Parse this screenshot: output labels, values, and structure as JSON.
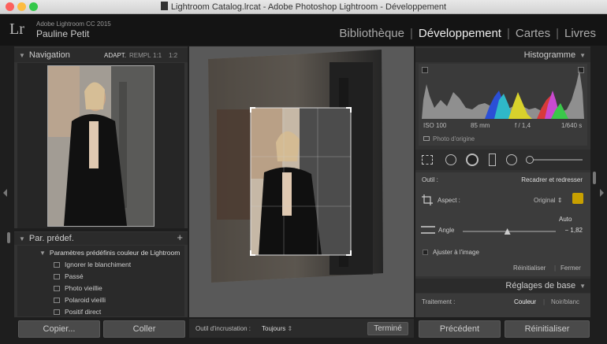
{
  "window": {
    "title": "Lightroom Catalog.lrcat - Adobe Photoshop Lightroom - Développement"
  },
  "identity": {
    "logo": "Lr",
    "app": "Adobe Lightroom CC 2015",
    "user": "Pauline Petit"
  },
  "modules": [
    {
      "label": "Bibliothèque"
    },
    {
      "label": "Développement"
    },
    {
      "label": "Cartes"
    },
    {
      "label": "Livres"
    }
  ],
  "navigator": {
    "title": "Navigation",
    "zoom_options": [
      "ADAPT.",
      "REMPL",
      "1:1",
      "1:2"
    ]
  },
  "presets": {
    "title": "Par. prédef.",
    "folder": "Paramètres prédéfinis couleur de Lightroom",
    "items": [
      "Ignorer le blanchiment",
      "Passé",
      "Photo vieillie",
      "Polaroid vieilli",
      "Positif direct"
    ]
  },
  "left_buttons": {
    "copy": "Copier...",
    "paste": "Coller"
  },
  "toolbar": {
    "overlay_label": "Outil d'incrustation :",
    "overlay_value": "Toujours",
    "done": "Terminé"
  },
  "histogram": {
    "title": "Histogramme",
    "iso": "ISO 100",
    "focal": "85 mm",
    "aperture": "f / 1,4",
    "shutter": "1/640 s",
    "original_photo": "Photo d'origine"
  },
  "crop": {
    "tool_label": "Outil :",
    "tool_name": "Recadrer et redresser",
    "aspect_label": "Aspect :",
    "aspect_value": "Original",
    "auto": "Auto",
    "angle_label": "Angle",
    "angle_value": "− 1,82",
    "angle_slider_fraction": 0.48,
    "constrain": "Ajuster à l'image",
    "reset": "Réinitialiser",
    "close": "Fermer"
  },
  "basic": {
    "title": "Réglages de base",
    "treatment_label": "Traitement :",
    "color": "Couleur",
    "bw": "Noir/blanc"
  },
  "right_buttons": {
    "previous": "Précédent",
    "reset": "Réinitialiser"
  },
  "colors": {
    "background": "#1e1e1e",
    "panel": "#333333",
    "header": "#2b2b2b",
    "canvas": "#595959"
  }
}
